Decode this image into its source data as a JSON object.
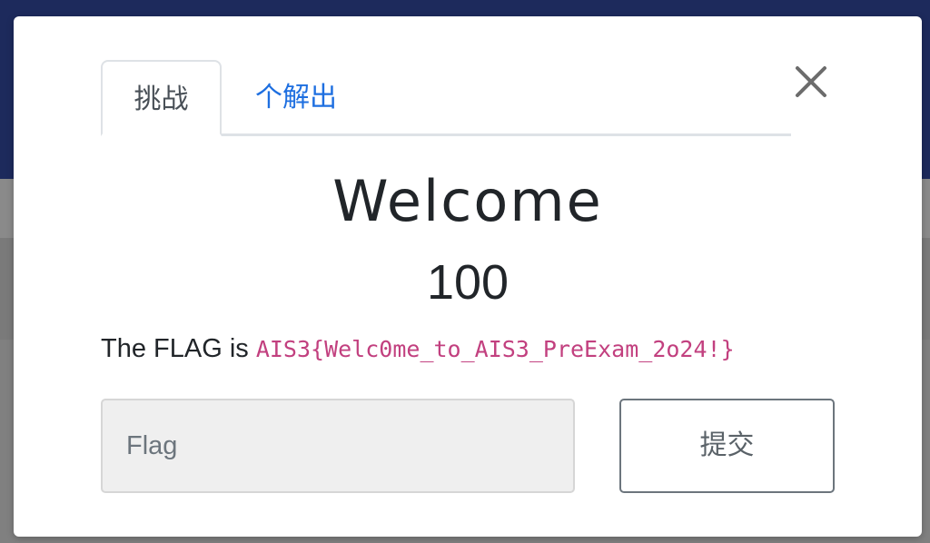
{
  "modal": {
    "tabs": [
      {
        "label": "挑战",
        "active": true
      },
      {
        "label": "个解出",
        "active": false
      }
    ],
    "close_icon": "close-icon",
    "challenge": {
      "name": "Welcome",
      "value": "100",
      "description_prefix": "The FLAG is ",
      "flag_text": "AIS3{Welc0me_to_AIS3_PreExam_2o24!}"
    },
    "submission": {
      "input_value": "",
      "input_placeholder": "Flag",
      "submit_label": "提交"
    }
  },
  "colors": {
    "navbar": "#1d2a5c",
    "accent_link": "#1e6fe0",
    "code_text": "#c2407f"
  }
}
